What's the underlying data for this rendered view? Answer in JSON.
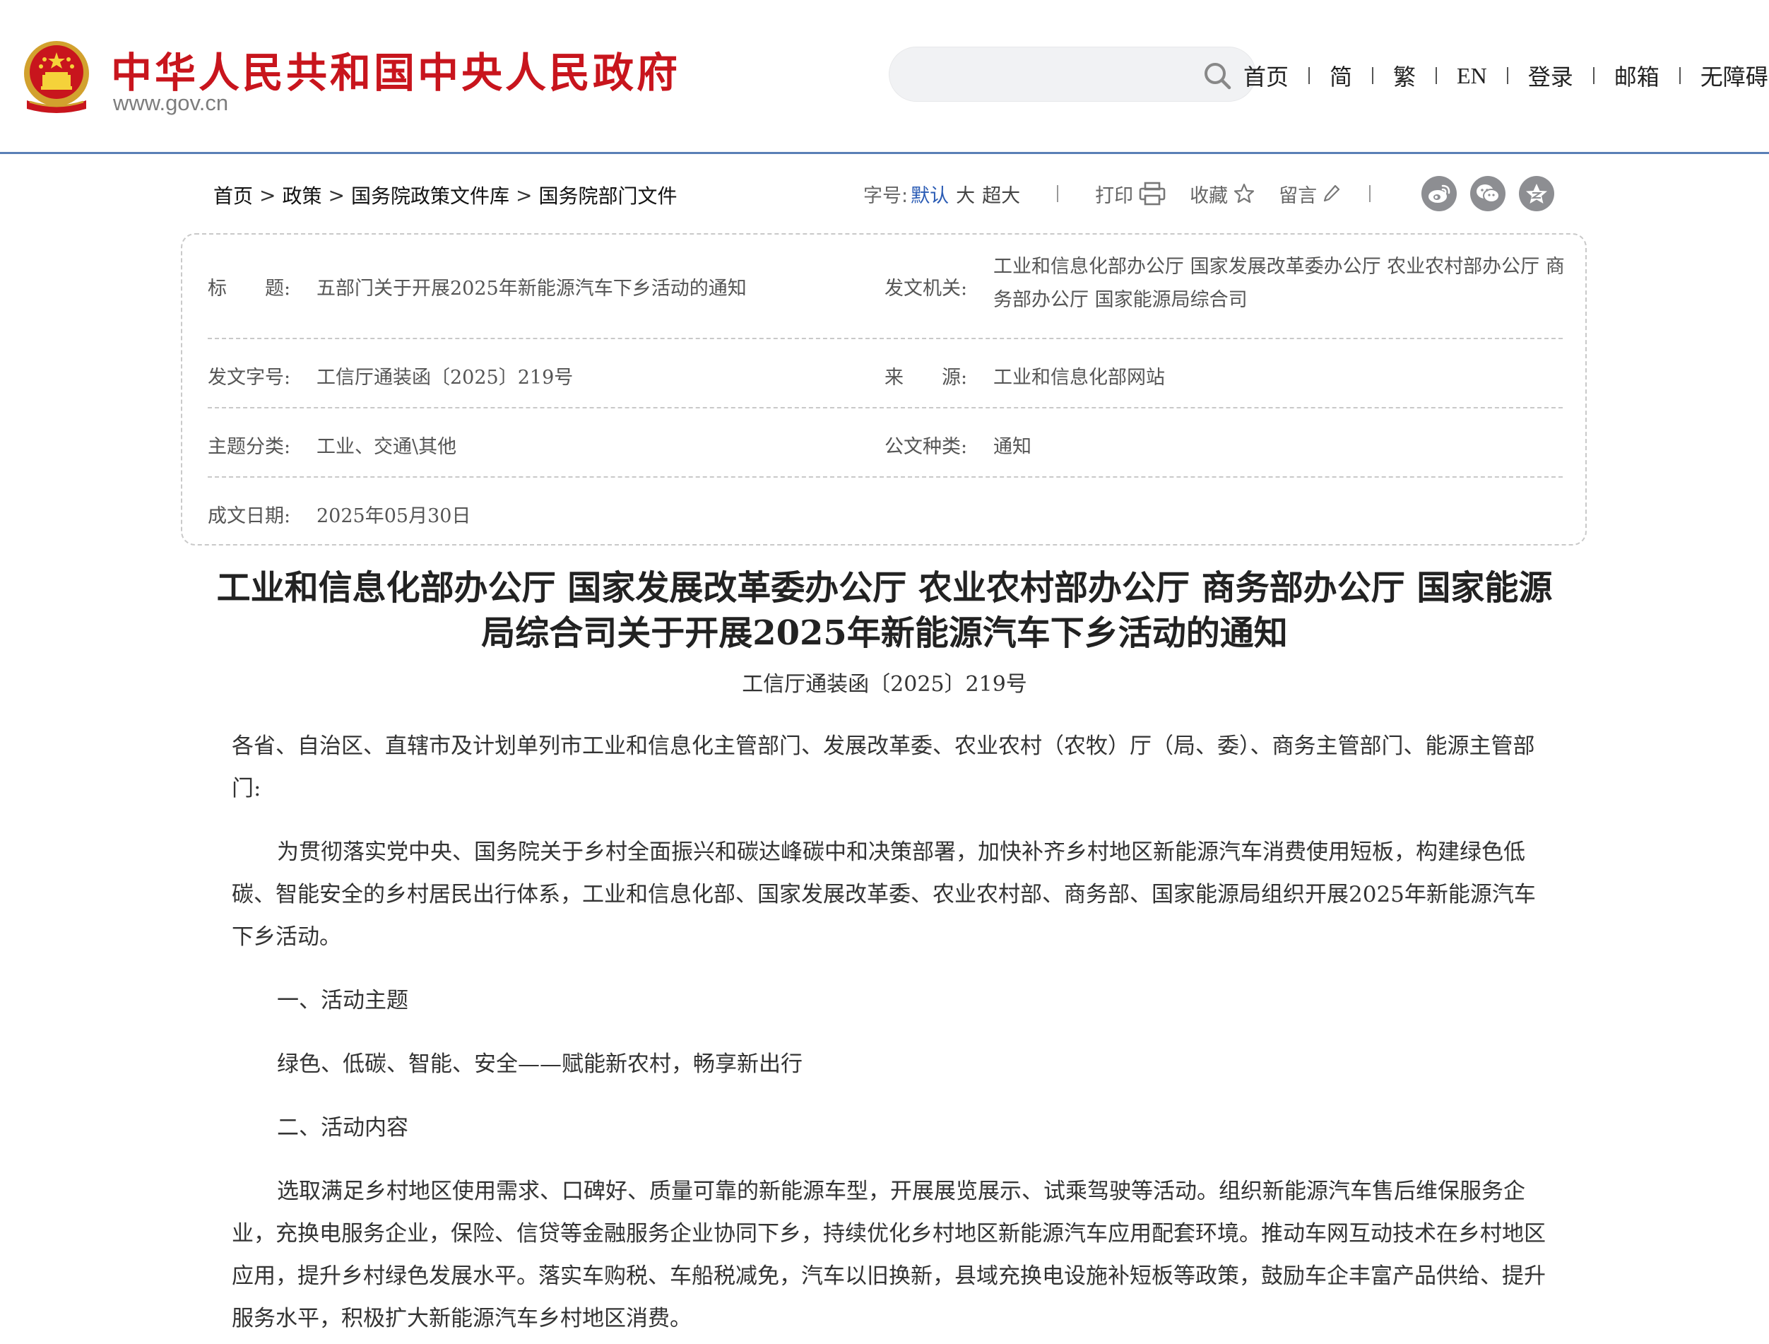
{
  "header": {
    "site_title": "中华人民共和国中央人民政府",
    "site_url": "www.gov.cn",
    "search_placeholder": "",
    "nav": [
      "首页",
      "简",
      "繁",
      "EN",
      "登录",
      "邮箱",
      "无障碍"
    ]
  },
  "breadcrumb": [
    "首页",
    "政策",
    "国务院政策文件库",
    "国务院部门文件"
  ],
  "tools": {
    "font_label": "字号:",
    "font_default": "默认",
    "font_large": "大",
    "font_xlarge": "超大",
    "print": "打印",
    "favorite": "收藏",
    "comment": "留言"
  },
  "meta": {
    "title_label": "标　　题:",
    "title_value": "五部门关于开展2025年新能源汽车下乡活动的通知",
    "issuer_label": "发文机关:",
    "issuer_value": "工业和信息化部办公厅 国家发展改革委办公厅 农业农村部办公厅 商务部办公厅 国家能源局综合司",
    "docno_label": "发文字号:",
    "docno_value": "工信厅通装函〔2025〕219号",
    "source_label": "来　　源:",
    "source_value": "工业和信息化部网站",
    "topic_label": "主题分类:",
    "topic_value": "工业、交通\\其他",
    "type_label": "公文种类:",
    "type_value": "通知",
    "date_label": "成文日期:",
    "date_value": "2025年05月30日"
  },
  "article": {
    "title_line1": "工业和信息化部办公厅 国家发展改革委办公厅 农业农村部办公厅 商务部办公厅 国家能源",
    "title_line2": "局综合司关于开展2025年新能源汽车下乡活动的通知",
    "doc_number": "工信厅通装函〔2025〕219号",
    "salutation": "各省、自治区、直辖市及计划单列市工业和信息化主管部门、发展改革委、农业农村（农牧）厅（局、委）、商务主管部门、能源主管部门:",
    "para1": "为贯彻落实党中央、国务院关于乡村全面振兴和碳达峰碳中和决策部署，加快补齐乡村地区新能源汽车消费使用短板，构建绿色低碳、智能安全的乡村居民出行体系，工业和信息化部、国家发展改革委、农业农村部、商务部、国家能源局组织开展2025年新能源汽车下乡活动。",
    "heading1": "一、活动主题",
    "theme": "绿色、低碳、智能、安全——赋能新农村，畅享新出行",
    "heading2": "二、活动内容",
    "para2": "选取满足乡村地区使用需求、口碑好、质量可靠的新能源车型，开展展览展示、试乘驾驶等活动。组织新能源汽车售后维保服务企业，充换电服务企业，保险、信贷等金融服务企业协同下乡，持续优化乡村地区新能源汽车应用配套环境。推动车网互动技术在乡村地区应用，提升乡村绿色发展水平。落实车购税、车船税减免，汽车以旧换新，县域充换电设施补短板等政策，鼓励车企丰富产品供给、提升服务水平，积极扩大新能源汽车乡村地区消费。"
  },
  "colors": {
    "brand_red": "#c8151d",
    "link_blue": "#2a5bb4",
    "header_rule": "#5a7fb6",
    "share_gray": "#8d8e92"
  },
  "icons": [
    "national-emblem-icon",
    "search-icon",
    "print-icon",
    "star-icon",
    "pencil-icon",
    "weibo-icon",
    "wechat-icon",
    "qzone-icon"
  ]
}
